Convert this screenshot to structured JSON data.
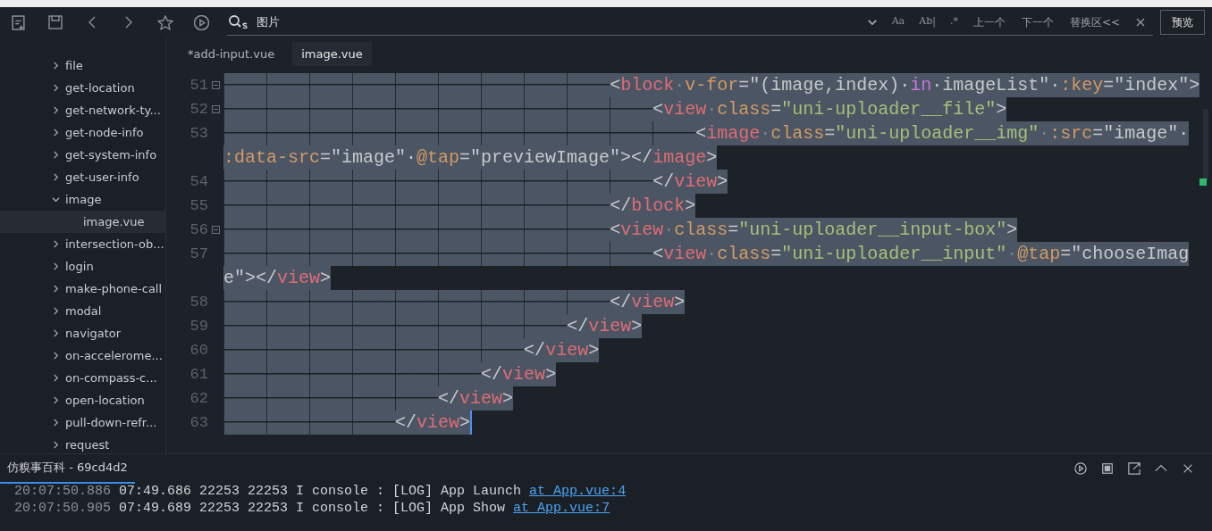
{
  "toolbar": {
    "search": {
      "value": "图片"
    },
    "options": [
      {
        "kind": "icon",
        "label": "Aa"
      },
      {
        "kind": "icon",
        "label": "Ab|"
      },
      {
        "kind": "icon",
        "label": ".*"
      },
      {
        "kind": "text",
        "label": "上一个"
      },
      {
        "kind": "text",
        "label": "下一个"
      },
      {
        "kind": "text",
        "label": "替换区<<"
      }
    ],
    "preview_button": "预览"
  },
  "sidebar": {
    "items": [
      {
        "label": "file",
        "expanded": false,
        "selected": false
      },
      {
        "label": "get-location",
        "expanded": false,
        "selected": false
      },
      {
        "label": "get-network-ty...",
        "expanded": false,
        "selected": false
      },
      {
        "label": "get-node-info",
        "expanded": false,
        "selected": false
      },
      {
        "label": "get-system-info",
        "expanded": false,
        "selected": false
      },
      {
        "label": "get-user-info",
        "expanded": false,
        "selected": false
      },
      {
        "label": "image",
        "expanded": true,
        "selected": false,
        "children": [
          {
            "label": "image.vue",
            "selected": true
          }
        ]
      },
      {
        "label": "intersection-ob...",
        "expanded": false,
        "selected": false
      },
      {
        "label": "login",
        "expanded": false,
        "selected": false
      },
      {
        "label": "make-phone-call",
        "expanded": false,
        "selected": false
      },
      {
        "label": "modal",
        "expanded": false,
        "selected": false
      },
      {
        "label": "navigator",
        "expanded": false,
        "selected": false
      },
      {
        "label": "on-accelerome...",
        "expanded": false,
        "selected": false
      },
      {
        "label": "on-compass-c...",
        "expanded": false,
        "selected": false
      },
      {
        "label": "open-location",
        "expanded": false,
        "selected": false
      },
      {
        "label": "pull-down-refr...",
        "expanded": false,
        "selected": false
      },
      {
        "label": "request",
        "expanded": false,
        "selected": false
      }
    ]
  },
  "tabs": [
    {
      "label": "*add-input.vue",
      "selected": false
    },
    {
      "label": "image.vue",
      "selected": true
    }
  ],
  "editor": {
    "rows": [
      {
        "number": "51",
        "fold": true,
        "selected": true,
        "tokens": [
          {
            "kind": "tab",
            "text": "────────────────────────────────────"
          },
          {
            "kind": "punct",
            "text": "<"
          },
          {
            "kind": "tag",
            "text": "block"
          },
          {
            "kind": "plain",
            "text": "·"
          },
          {
            "kind": "attr",
            "text": "v-for"
          },
          {
            "kind": "punct",
            "text": "=\"(image,index)·"
          },
          {
            "kind": "keyword",
            "text": "in"
          },
          {
            "kind": "punct",
            "text": "·imageList\"·"
          },
          {
            "kind": "attr",
            "text": ":key"
          },
          {
            "kind": "punct",
            "text": "=\"index\">"
          }
        ]
      },
      {
        "number": "52",
        "fold": true,
        "selected": true,
        "tokens": [
          {
            "kind": "tab",
            "text": "────────────────────────────────────────"
          },
          {
            "kind": "punct",
            "text": "<"
          },
          {
            "kind": "tag",
            "text": "view"
          },
          {
            "kind": "plain",
            "text": "·"
          },
          {
            "kind": "attr",
            "text": "class"
          },
          {
            "kind": "punct",
            "text": "="
          },
          {
            "kind": "string",
            "text": "\"uni-uploader__file\""
          },
          {
            "kind": "punct",
            "text": ">"
          }
        ]
      },
      {
        "number": "53",
        "fold": false,
        "selected": true,
        "tokens": [
          {
            "kind": "tab",
            "text": "────────────────────────────────────────────"
          },
          {
            "kind": "punct",
            "text": "<"
          },
          {
            "kind": "tag",
            "text": "image"
          },
          {
            "kind": "plain",
            "text": "·"
          },
          {
            "kind": "attr",
            "text": "class"
          },
          {
            "kind": "punct",
            "text": "="
          },
          {
            "kind": "string",
            "text": "\"uni-uploader__img\""
          },
          {
            "kind": "plain",
            "text": "·"
          },
          {
            "kind": "attr",
            "text": ":src"
          },
          {
            "kind": "punct",
            "text": "=\"image\"·"
          }
        ]
      },
      {
        "number": "",
        "fold": false,
        "selected": true,
        "tokens": [
          {
            "kind": "attr",
            "text": ":data-src"
          },
          {
            "kind": "punct",
            "text": "=\"image\"·"
          },
          {
            "kind": "attr",
            "text": "@tap"
          },
          {
            "kind": "punct",
            "text": "=\"previewImage\"></"
          },
          {
            "kind": "tag",
            "text": "image"
          },
          {
            "kind": "punct",
            "text": ">"
          }
        ]
      },
      {
        "number": "54",
        "fold": false,
        "selected": true,
        "tokens": [
          {
            "kind": "tab",
            "text": "────────────────────────────────────────"
          },
          {
            "kind": "punct",
            "text": "</"
          },
          {
            "kind": "tag",
            "text": "view"
          },
          {
            "kind": "punct",
            "text": ">"
          }
        ]
      },
      {
        "number": "55",
        "fold": false,
        "selected": true,
        "tokens": [
          {
            "kind": "tab",
            "text": "────────────────────────────────────"
          },
          {
            "kind": "punct",
            "text": "</"
          },
          {
            "kind": "tag",
            "text": "block"
          },
          {
            "kind": "punct",
            "text": ">"
          }
        ]
      },
      {
        "number": "56",
        "fold": true,
        "selected": true,
        "tokens": [
          {
            "kind": "tab",
            "text": "────────────────────────────────────"
          },
          {
            "kind": "punct",
            "text": "<"
          },
          {
            "kind": "tag",
            "text": "view"
          },
          {
            "kind": "plain",
            "text": "·"
          },
          {
            "kind": "attr",
            "text": "class"
          },
          {
            "kind": "punct",
            "text": "="
          },
          {
            "kind": "string",
            "text": "\"uni-uploader__input-box\""
          },
          {
            "kind": "punct",
            "text": ">"
          }
        ]
      },
      {
        "number": "57",
        "fold": false,
        "selected": true,
        "tokens": [
          {
            "kind": "tab",
            "text": "────────────────────────────────────────"
          },
          {
            "kind": "punct",
            "text": "<"
          },
          {
            "kind": "tag",
            "text": "view"
          },
          {
            "kind": "plain",
            "text": "·"
          },
          {
            "kind": "attr",
            "text": "class"
          },
          {
            "kind": "punct",
            "text": "="
          },
          {
            "kind": "string",
            "text": "\"uni-uploader__input\""
          },
          {
            "kind": "plain",
            "text": "·"
          },
          {
            "kind": "attr",
            "text": "@tap"
          },
          {
            "kind": "punct",
            "text": "=\"chooseImag"
          }
        ]
      },
      {
        "number": "",
        "fold": false,
        "selected": true,
        "tokens": [
          {
            "kind": "punct",
            "text": "e\"></"
          },
          {
            "kind": "tag",
            "text": "view"
          },
          {
            "kind": "punct",
            "text": ">"
          }
        ]
      },
      {
        "number": "58",
        "fold": false,
        "selected": true,
        "tokens": [
          {
            "kind": "tab",
            "text": "────────────────────────────────────"
          },
          {
            "kind": "punct",
            "text": "</"
          },
          {
            "kind": "tag",
            "text": "view"
          },
          {
            "kind": "punct",
            "text": ">"
          }
        ]
      },
      {
        "number": "59",
        "fold": false,
        "selected": true,
        "tokens": [
          {
            "kind": "tab",
            "text": "────────────────────────────────"
          },
          {
            "kind": "punct",
            "text": "</"
          },
          {
            "kind": "tag",
            "text": "view"
          },
          {
            "kind": "punct",
            "text": ">"
          }
        ]
      },
      {
        "number": "60",
        "fold": false,
        "selected": true,
        "tokens": [
          {
            "kind": "tab",
            "text": "────────────────────────────"
          },
          {
            "kind": "punct",
            "text": "</"
          },
          {
            "kind": "tag",
            "text": "view"
          },
          {
            "kind": "punct",
            "text": ">"
          }
        ]
      },
      {
        "number": "61",
        "fold": false,
        "selected": true,
        "tokens": [
          {
            "kind": "tab",
            "text": "────────────────────────"
          },
          {
            "kind": "punct",
            "text": "</"
          },
          {
            "kind": "tag",
            "text": "view"
          },
          {
            "kind": "punct",
            "text": ">"
          }
        ]
      },
      {
        "number": "62",
        "fold": false,
        "selected": true,
        "tokens": [
          {
            "kind": "tab",
            "text": "────────────────────"
          },
          {
            "kind": "punct",
            "text": "</"
          },
          {
            "kind": "tag",
            "text": "view"
          },
          {
            "kind": "punct",
            "text": ">"
          }
        ]
      },
      {
        "number": "63",
        "fold": false,
        "selected": true,
        "tokens": [
          {
            "kind": "tab",
            "text": "────────────────"
          },
          {
            "kind": "punct",
            "text": "</"
          },
          {
            "kind": "tag",
            "text": "view"
          },
          {
            "kind": "punct",
            "text": ">"
          }
        ]
      }
    ]
  },
  "console": {
    "tabs": [
      {
        "label": "仿糗事百科 - 69cd4d2",
        "selected": true
      }
    ],
    "lines": [
      {
        "time": "20:07:50.886",
        "text": " 07:49.686 22253 22253 I console : [LOG] App Launch ",
        "link": "at App.vue:4"
      },
      {
        "time": "20:07:50.905",
        "text": " 07:49.689 22253 22253 I console : [LOG] App Show ",
        "link": "at App.vue:7"
      }
    ]
  }
}
